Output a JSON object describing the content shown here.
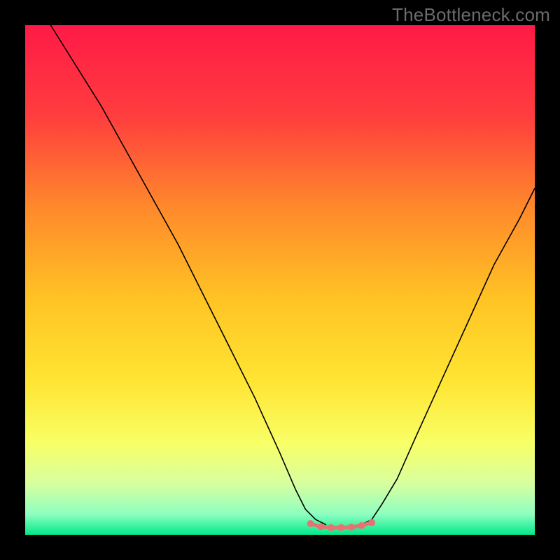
{
  "watermark": "TheBottleneck.com",
  "gradient": {
    "stops": [
      {
        "offset": 0.0,
        "color": "#ff1a47"
      },
      {
        "offset": 0.18,
        "color": "#ff3e3e"
      },
      {
        "offset": 0.36,
        "color": "#ff8a2b"
      },
      {
        "offset": 0.54,
        "color": "#ffc424"
      },
      {
        "offset": 0.7,
        "color": "#ffe533"
      },
      {
        "offset": 0.82,
        "color": "#f8ff66"
      },
      {
        "offset": 0.9,
        "color": "#d7ffa0"
      },
      {
        "offset": 0.96,
        "color": "#8dffc0"
      },
      {
        "offset": 1.0,
        "color": "#00e88a"
      }
    ]
  },
  "chart_data": {
    "type": "line",
    "title": "",
    "xlabel": "",
    "ylabel": "",
    "xlim": [
      0,
      100
    ],
    "ylim": [
      0,
      100
    ],
    "grid": false,
    "legend": false,
    "series": [
      {
        "name": "left-branch",
        "x": [
          5,
          10,
          15,
          20,
          25,
          30,
          35,
          40,
          45,
          50,
          53,
          55,
          57,
          59
        ],
        "y": [
          100,
          92,
          84,
          75,
          66,
          57,
          47,
          37,
          27,
          16,
          9,
          5,
          3,
          2
        ],
        "stroke": "#000000",
        "width": 1.6
      },
      {
        "name": "right-branch",
        "x": [
          66,
          68,
          70,
          73,
          77,
          82,
          87,
          92,
          97,
          100
        ],
        "y": [
          2,
          3,
          6,
          11,
          20,
          31,
          42,
          53,
          62,
          68
        ],
        "stroke": "#000000",
        "width": 1.6
      },
      {
        "name": "flat-bottom",
        "x": [
          56,
          58,
          60,
          62,
          64,
          66,
          68
        ],
        "y": [
          2.2,
          1.6,
          1.4,
          1.4,
          1.5,
          1.8,
          2.4
        ],
        "stroke": "#e57373",
        "width": 5.5,
        "dots": true,
        "dot_radius": 5
      }
    ]
  }
}
